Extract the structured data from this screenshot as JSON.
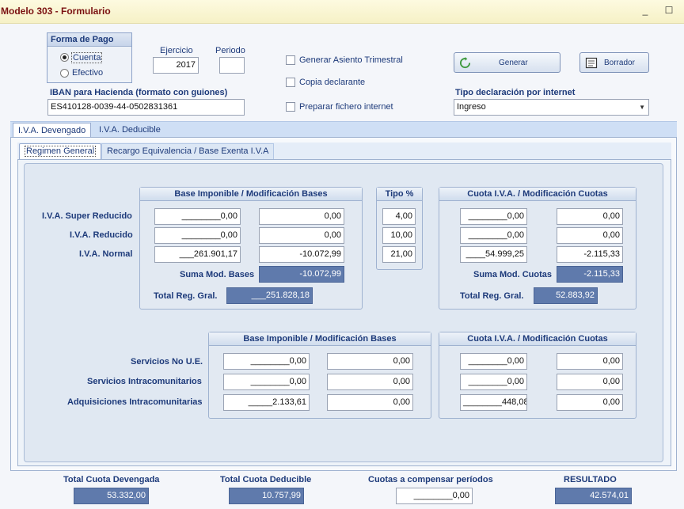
{
  "window": {
    "title": "Modelo 303 - Formulario",
    "minimize": "_",
    "maximize": "☐"
  },
  "forma_pago": {
    "title": "Forma de Pago",
    "options": [
      "Cuenta",
      "Efectivo"
    ],
    "selected": "Cuenta"
  },
  "ejercicio": {
    "label": "Ejercicio",
    "value": "2017"
  },
  "periodo": {
    "label": "Periodo",
    "value": ""
  },
  "checks": {
    "generar_asiento": "Generar Asiento Trimestral",
    "copia_declarante": "Copia declarante",
    "preparar_fichero": "Preparar fichero internet"
  },
  "buttons": {
    "generar": "Generar",
    "borrador": "Borrador"
  },
  "iban": {
    "label": "IBAN para Hacienda (formato con guiones)",
    "value": "ES410128-0039-44-0502831361"
  },
  "tipo_decl": {
    "label": "Tipo declaración por internet",
    "value": "Ingreso"
  },
  "tabs": {
    "devengado": "I.V.A. Devengado",
    "deducible": "I.V.A. Deducible"
  },
  "subtabs": {
    "general": "Regimen General",
    "recargo": "Recargo Equivalencia / Base Exenta I.V.A"
  },
  "headers": {
    "base": "Base Imponible   /   Modificación Bases",
    "tipo": "Tipo %",
    "cuota": "Cuota I.V.A.  /  Modificación Cuotas"
  },
  "rows1": [
    {
      "label": "I.V.A. Super Reducido",
      "base": "________0,00",
      "mod_base": "0,00",
      "tipo": "4,00",
      "cuota": "________0,00",
      "mod_cuota": "0,00"
    },
    {
      "label": "I.V.A. Reducido",
      "base": "________0,00",
      "mod_base": "0,00",
      "tipo": "10,00",
      "cuota": "________0,00",
      "mod_cuota": "0,00"
    },
    {
      "label": "I.V.A. Normal",
      "base": "___261.901,17",
      "mod_base": "-10.072,99",
      "tipo": "21,00",
      "cuota": "____54.999,25",
      "mod_cuota": "-2.115,33"
    }
  ],
  "suma_mod_bases": {
    "label": "Suma Mod. Bases",
    "value": "-10.072,99"
  },
  "suma_mod_cuotas": {
    "label": "Suma Mod. Cuotas",
    "value": "-2.115,33"
  },
  "total_base": {
    "label": "Total Reg. Gral.",
    "value": "___251.828,18"
  },
  "total_cuota": {
    "label": "Total Reg. Gral.",
    "value": "52.883,92"
  },
  "rows2": [
    {
      "label": "Servicios No U.E.",
      "base": "________0,00",
      "mod_base": "0,00",
      "cuota": "________0,00",
      "mod_cuota": "0,00"
    },
    {
      "label": "Servicios Intracomunitarios",
      "base": "________0,00",
      "mod_base": "0,00",
      "cuota": "________0,00",
      "mod_cuota": "0,00"
    },
    {
      "label": "Adquisiciones Intracomunitarias",
      "base": "_____2.133,61",
      "mod_base": "0,00",
      "cuota": "________448,08",
      "mod_cuota": "0,00"
    }
  ],
  "footer": {
    "devengada": {
      "label": "Total Cuota Devengada",
      "value": "53.332,00"
    },
    "deducible": {
      "label": "Total Cuota Deducible",
      "value": "10.757,99"
    },
    "compensar": {
      "label": "Cuotas a compensar períodos",
      "value": "________0,00"
    },
    "resultado": {
      "label": "RESULTADO",
      "value": "42.574,01"
    }
  }
}
